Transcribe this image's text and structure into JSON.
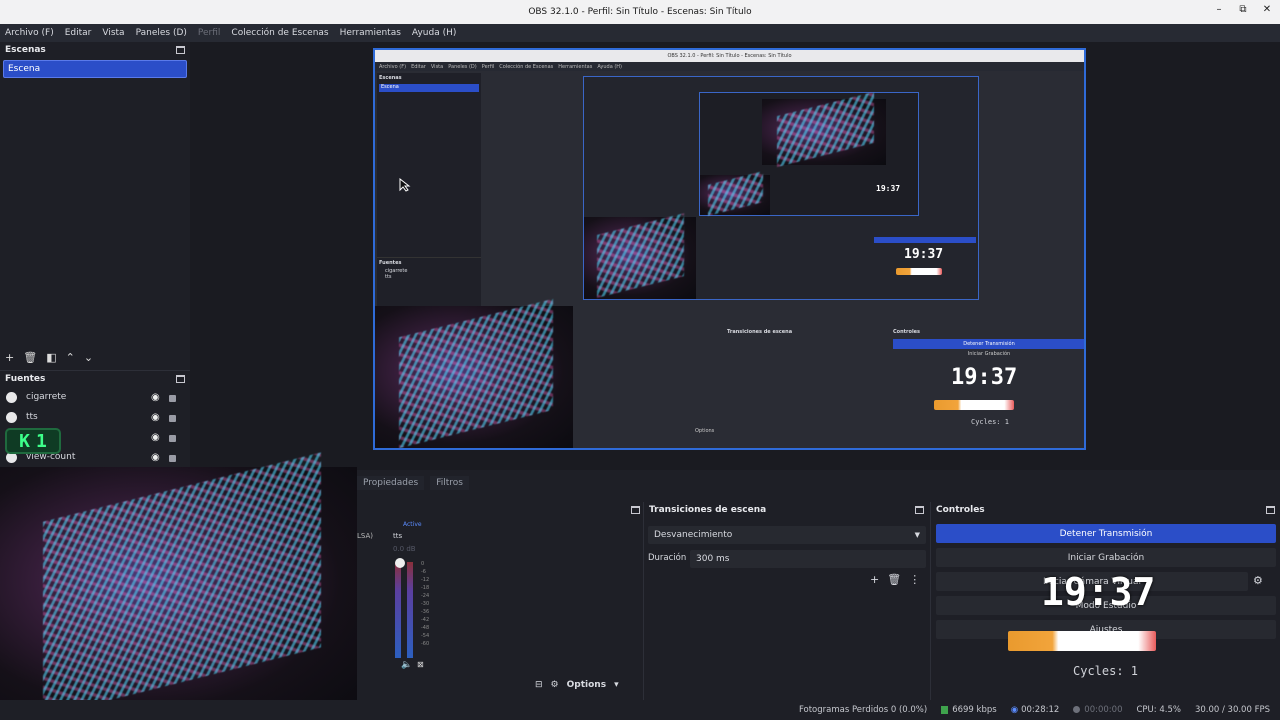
{
  "window": {
    "title": "OBS 32.1.0 - Perfil: Sin Título - Escenas: Sin Título"
  },
  "menu": [
    "Archivo (F)",
    "Editar",
    "Vista",
    "Paneles (D)",
    "Perfil",
    "Colección de Escenas",
    "Herramientas",
    "Ayuda (H)"
  ],
  "scenes": {
    "title": "Escenas",
    "items": [
      "Escena"
    ]
  },
  "sources": {
    "title": "Fuentes",
    "items": [
      "cigarrete",
      "tts",
      "K1",
      "view-count"
    ]
  },
  "overlay": {
    "k1_letter": "K",
    "k1_num": "1"
  },
  "preview": {
    "nested_title": "OBS 32.1.0 - Perfil: Sin Título - Escenas: Sin Título",
    "nested_clock": "19:37",
    "mid_clock": "19:37",
    "big_clock": "19:37",
    "cycles": "Cycles: 1",
    "nested_menu": [
      "Archivo (F)",
      "Editar",
      "Vista",
      "Paneles (D)",
      "Perfil",
      "Colección de Escenas",
      "Herramientas",
      "Ayuda (H)"
    ],
    "nested_scenes": "Escenas",
    "nested_scene_item": "Escena",
    "nested_sources": "Fuentes",
    "nested_source_items": [
      "cigarrete",
      "tts"
    ],
    "nested_trans": "Transiciones de escena",
    "nested_controls": "Controles",
    "nested_stop": "Detener Transmisión",
    "nested_rec": "Iniciar Grabación",
    "nested_cycles": "Cycles: 1",
    "nested_options": "Options"
  },
  "tabs": [
    "Propiedades",
    "Filtros"
  ],
  "mixer": {
    "channel": "tts",
    "device_fragment": "LSA)",
    "state": "Active",
    "db": "0.0 dB",
    "ticks": [
      "0",
      "-6",
      "-12",
      "-18",
      "-24",
      "-30",
      "-36",
      "-42",
      "-48",
      "-54",
      "-60"
    ]
  },
  "transitions": {
    "title": "Transiciones de escena",
    "type": "Desvanecimiento",
    "duration_label": "Duración",
    "duration_value": "300 ms"
  },
  "controls": {
    "title": "Controles",
    "buttons": [
      "Detener Transmisión",
      "Iniciar Grabación",
      "Iniciar Cámara Virtual",
      "Modo Estudio",
      "Ajustes"
    ],
    "clock": "19:37",
    "cycles": "Cycles: 1"
  },
  "dock_options": "Options",
  "status": {
    "dropped": "Fotogramas Perdidos 0 (0.0%)",
    "kbps": "6699 kbps",
    "stream_time": "00:28:12",
    "rec_time": "00:00:00",
    "cpu": "CPU: 4.5%",
    "fps": "30.00 / 30.00 FPS"
  },
  "colors": {
    "accent": "#2b4ec8",
    "preview_border": "#2f6bd8",
    "bg": "#1e1f26"
  }
}
